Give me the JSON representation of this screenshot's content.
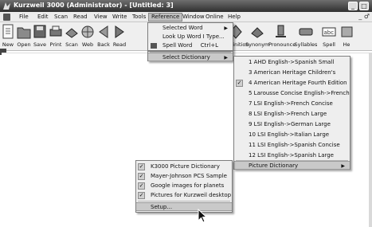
{
  "window": {
    "title": "Kurzweil 3000 (Administrator) - [Untitled: 3]"
  },
  "menubar": {
    "items": [
      "File",
      "Edit",
      "Scan",
      "Read",
      "View",
      "Write",
      "Tools",
      "Reference",
      "Window",
      "Online",
      "Help"
    ],
    "active": "Reference"
  },
  "toolbar": {
    "buttons": [
      "New",
      "Open",
      "Save",
      "Print",
      "Scan",
      "Web",
      "Back",
      "Read",
      "Definition",
      "Synonym",
      "Pronounce",
      "Syllables",
      "Spell",
      "He"
    ]
  },
  "reference_menu": {
    "items": [
      {
        "label": "Selected Word",
        "shortcut": "",
        "arrow": true,
        "icon": false
      },
      {
        "label": "Look Up Word I Type...",
        "shortcut": "",
        "arrow": false,
        "icon": false
      },
      {
        "label": "Spell Word",
        "shortcut": "Ctrl+L",
        "arrow": false,
        "icon": true
      },
      {
        "label": "Select Dictionary",
        "shortcut": "",
        "arrow": true,
        "icon": false
      }
    ]
  },
  "dictionary_menu": {
    "items": [
      {
        "label": "1 AHD English->Spanish Small",
        "checked": false
      },
      {
        "label": "3 American Heritage Children's",
        "checked": false
      },
      {
        "label": "4 American Heritage Fourth Edition",
        "checked": true
      },
      {
        "label": "5 Larousse Concise English->French",
        "checked": false
      },
      {
        "label": "7 LSI English->French Concise",
        "checked": false
      },
      {
        "label": "8 LSI English->French Large",
        "checked": false
      },
      {
        "label": "9 LSI English->German Large",
        "checked": false
      },
      {
        "label": "10 LSI English->Italian Large",
        "checked": false
      },
      {
        "label": "11 LSI English->Spanish Concise",
        "checked": false
      },
      {
        "label": "12 LSI English->Spanish Large",
        "checked": false
      }
    ],
    "picture_item": "Picture Dictionary"
  },
  "picture_menu": {
    "items": [
      {
        "label": "K3000 Picture Dictionary",
        "checked": true
      },
      {
        "label": "Mayer-Johnson PCS Sample",
        "checked": true
      },
      {
        "label": "Google images for planets",
        "checked": true
      },
      {
        "label": "Pictures for Kurzweil desktop",
        "checked": true
      }
    ],
    "setup": "Setup..."
  }
}
